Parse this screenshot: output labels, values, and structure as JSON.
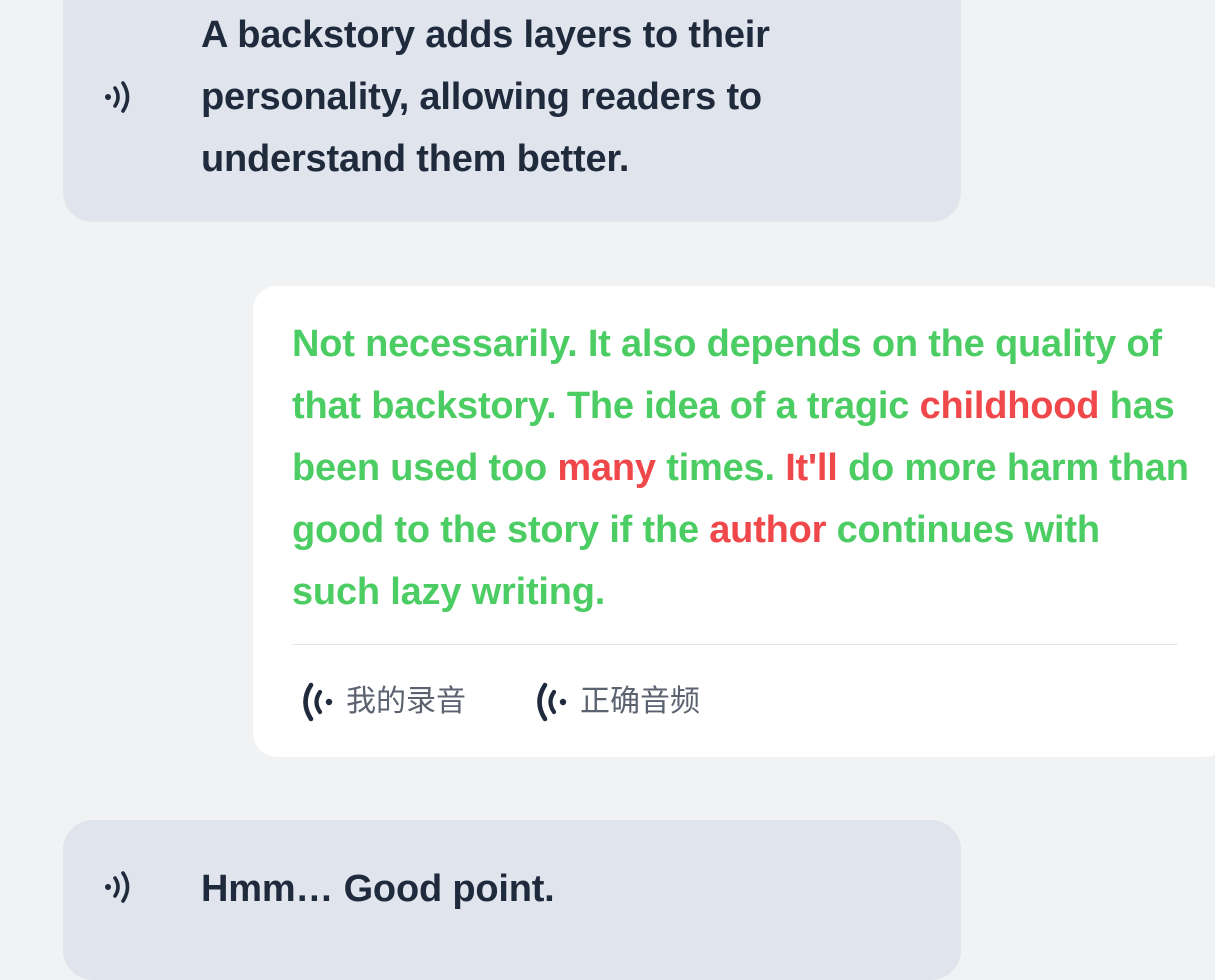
{
  "conversation": {
    "messages": [
      {
        "role": "partner",
        "text_lines": [
          "A backstory adds layers to their",
          "personality, allowing readers to",
          "understand them better."
        ],
        "icon": "speaker-icon"
      },
      {
        "role": "user",
        "words": [
          {
            "t": "Not",
            "ok": true
          },
          {
            "t": "necessarily.",
            "ok": true
          },
          {
            "t": "It",
            "ok": true
          },
          {
            "t": "also",
            "ok": true
          },
          {
            "t": "depends",
            "ok": true
          },
          {
            "t": "on",
            "ok": true
          },
          {
            "t": "the",
            "ok": true
          },
          {
            "t": "quality",
            "ok": true
          },
          {
            "t": "of",
            "ok": true
          },
          {
            "t": "that",
            "ok": true
          },
          {
            "t": "backstory.",
            "ok": true
          },
          {
            "t": "The",
            "ok": true
          },
          {
            "t": "idea",
            "ok": true
          },
          {
            "t": "of",
            "ok": true
          },
          {
            "t": "a",
            "ok": true
          },
          {
            "t": "tragic",
            "ok": true
          },
          {
            "t": "childhood",
            "ok": false
          },
          {
            "t": "has",
            "ok": true
          },
          {
            "t": "been",
            "ok": true
          },
          {
            "t": "used",
            "ok": true
          },
          {
            "t": "too",
            "ok": true
          },
          {
            "t": "many",
            "ok": false
          },
          {
            "t": "times.",
            "ok": true
          },
          {
            "t": "It'll",
            "ok": false
          },
          {
            "t": "do",
            "ok": true
          },
          {
            "t": "more",
            "ok": true
          },
          {
            "t": "harm",
            "ok": true
          },
          {
            "t": "than",
            "ok": true
          },
          {
            "t": "good",
            "ok": true
          },
          {
            "t": "to",
            "ok": true
          },
          {
            "t": "the",
            "ok": true
          },
          {
            "t": "story",
            "ok": true
          },
          {
            "t": "if",
            "ok": true
          },
          {
            "t": "the",
            "ok": true
          },
          {
            "t": "author",
            "ok": false
          },
          {
            "t": "continues",
            "ok": true
          },
          {
            "t": "with",
            "ok": true
          },
          {
            "t": "such",
            "ok": true
          },
          {
            "t": "lazy",
            "ok": true
          },
          {
            "t": "writing.",
            "ok": true
          }
        ],
        "audio_buttons": {
          "my_recording_label": "我的录音",
          "correct_audio_label": "正确音频"
        }
      },
      {
        "role": "partner",
        "text_lines": [
          "Hmm… Good point."
        ],
        "icon": "speaker-icon"
      }
    ]
  },
  "colors": {
    "correct": "#4ccd63",
    "incorrect": "#f0474a",
    "partner_bubble": "#e0e4ec",
    "user_bubble": "#ffffff",
    "background": "#f1f2f4",
    "text_dark": "#1f2a3c"
  }
}
